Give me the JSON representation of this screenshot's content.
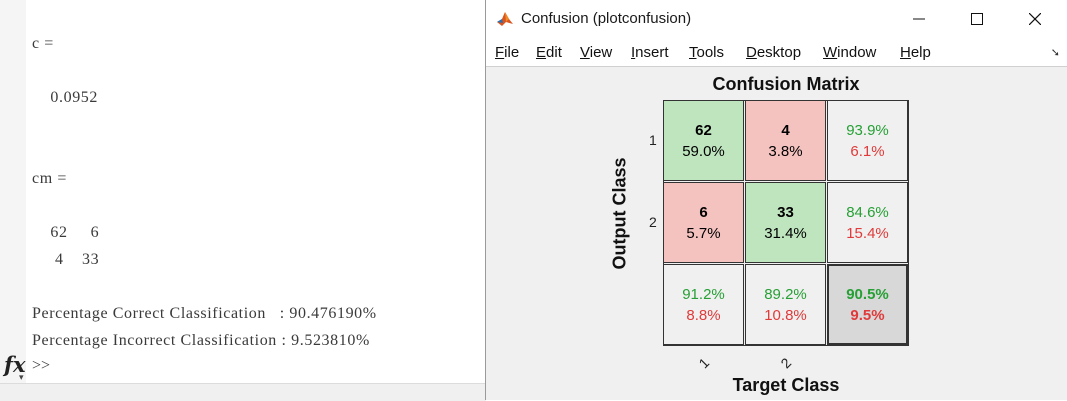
{
  "command_window": {
    "lines": [
      {
        "text": "c ="
      },
      {
        "text": "    0.0952"
      },
      {
        "text": "cm ="
      },
      {
        "text": "    62     6"
      },
      {
        "text": "     4    33"
      },
      {
        "text": "Percentage Correct Classification   : 90.476190%"
      },
      {
        "text": "Percentage Incorrect Classification : 9.523810%"
      }
    ],
    "fx_label": "fx",
    "prompt": ">>"
  },
  "figure": {
    "title": "Confusion (plotconfusion)",
    "menu": [
      "File",
      "Edit",
      "View",
      "Insert",
      "Tools",
      "Desktop",
      "Window",
      "Help"
    ],
    "menu_mnemonics": [
      "F",
      "E",
      "V",
      "I",
      "T",
      "D",
      "W",
      "H"
    ]
  },
  "chart_data": {
    "type": "table",
    "title": "Confusion Matrix",
    "xlabel": "Target Class",
    "ylabel": "Output Class",
    "row_ticks": [
      "1",
      "2"
    ],
    "col_ticks": [
      "1",
      "2"
    ],
    "cells": [
      [
        {
          "count": "62",
          "pct": "59.0%"
        },
        {
          "count": "4",
          "pct": "3.8%"
        },
        {
          "good": "93.9%",
          "bad": "6.1%"
        }
      ],
      [
        {
          "count": "6",
          "pct": "5.7%"
        },
        {
          "count": "33",
          "pct": "31.4%"
        },
        {
          "good": "84.6%",
          "bad": "15.4%"
        }
      ],
      [
        {
          "good": "91.2%",
          "bad": "8.8%"
        },
        {
          "good": "89.2%",
          "bad": "10.8%"
        },
        {
          "good": "90.5%",
          "bad": "9.5%"
        }
      ]
    ],
    "colors": {
      "correct_cell": "#bfe5bf",
      "incorrect_cell": "#f4c3c0",
      "summary_cell": "#f0f0f0",
      "overall_cell": "#d8d8d8",
      "good_text": "#26a035",
      "bad_text": "#e03a3a"
    }
  }
}
